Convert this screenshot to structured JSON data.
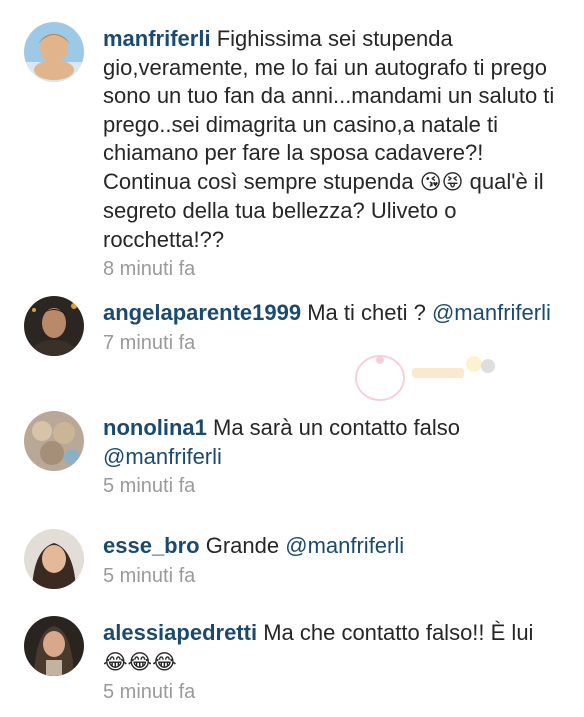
{
  "comments": [
    {
      "username": "manfriferli",
      "text_a": " Fighissima sei stupenda gio,veramente, me lo fai un autografo ti prego sono un tuo fan da anni...mandami un saluto ti prego..sei dimagrita un casino,a natale ti chiamano per fare la sposa cadavere?! Continua così sempre stupenda ",
      "emoji": "😘😝",
      "text_b": " qual'è il segreto della tua bellezza? Uliveto o rocchetta!??",
      "time": "8 minuti fa"
    },
    {
      "username": "angelaparente1999",
      "text": " Ma ti cheti ? ",
      "mention": "@manfriferli",
      "time": "7 minuti fa"
    },
    {
      "username": "nonolina1",
      "text": " Ma sarà un contatto falso ",
      "mention": "@manfriferli",
      "time": "5 minuti fa"
    },
    {
      "username": "esse_bro",
      "text": " Grande ",
      "mention": "@manfriferli",
      "time": "5 minuti fa"
    },
    {
      "username": "alessiapedretti",
      "text": " Ma che contatto falso!! È lui ",
      "emoji": "😂😂😂",
      "time": "5 minuti fa"
    }
  ]
}
